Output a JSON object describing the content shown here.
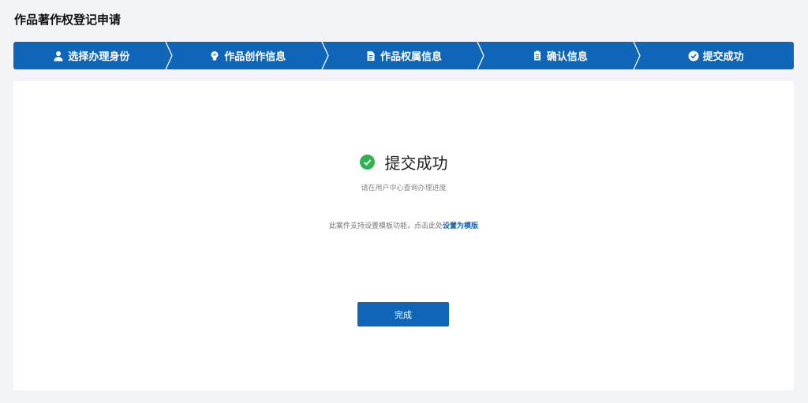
{
  "page": {
    "title": "作品著作权登记申请"
  },
  "steps": [
    {
      "label": "选择办理身份",
      "icon": "user-icon"
    },
    {
      "label": "作品创作信息",
      "icon": "lightbulb-icon"
    },
    {
      "label": "作品权属信息",
      "icon": "document-icon"
    },
    {
      "label": "确认信息",
      "icon": "confirm-document-icon"
    },
    {
      "label": "提交成功",
      "icon": "check-circle-icon"
    }
  ],
  "result": {
    "title": "提交成功",
    "subtitle": "请在用户中心查询办理进度",
    "template_note": "此案件支持设置模板功能，点击此处",
    "template_link": "设置为模版"
  },
  "actions": {
    "done_label": "完成"
  },
  "colors": {
    "primary": "#0f66b8",
    "success": "#2fb24f",
    "background": "#f2f4f7"
  }
}
